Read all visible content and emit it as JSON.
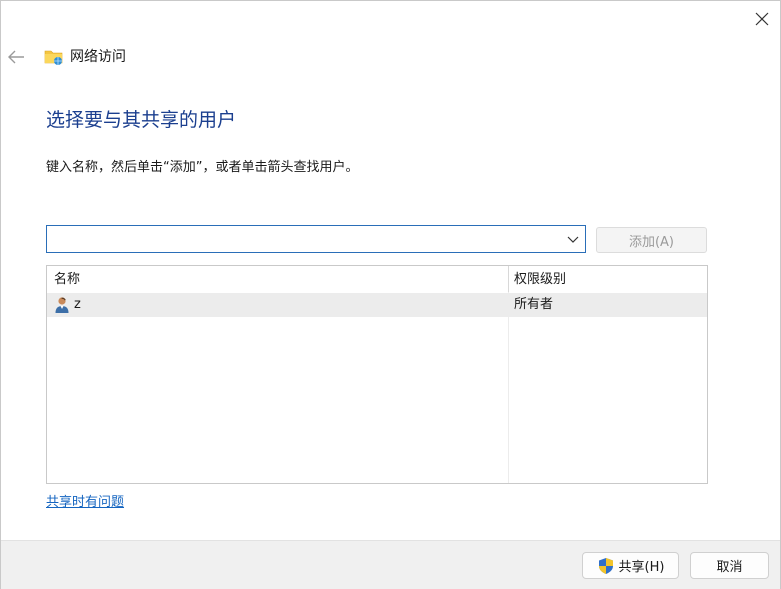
{
  "window": {
    "title": "网络访问",
    "close_icon": "close-icon",
    "back_icon": "back-arrow-icon",
    "title_icon": "network-folder-icon"
  },
  "main": {
    "heading": "选择要与其共享的用户",
    "instruction": "键入名称，然后单击“添加”，或者单击箭头查找用户。",
    "combo_value": "",
    "add_label": "添加(A)",
    "columns": [
      "名称",
      "权限级别"
    ],
    "rows": [
      {
        "name": "z",
        "level": "所有者",
        "icon": "user-icon"
      }
    ],
    "help_link": "共享时有问题"
  },
  "footer": {
    "share_label": "共享(H)",
    "cancel_label": "取消",
    "share_icon": "uac-shield-icon"
  },
  "colors": {
    "heading": "#1b3f8f",
    "link": "#1565c0",
    "focus_border": "#2a6eb8",
    "row_highlight": "#ececec",
    "footer_bg": "#f0f0f0"
  }
}
